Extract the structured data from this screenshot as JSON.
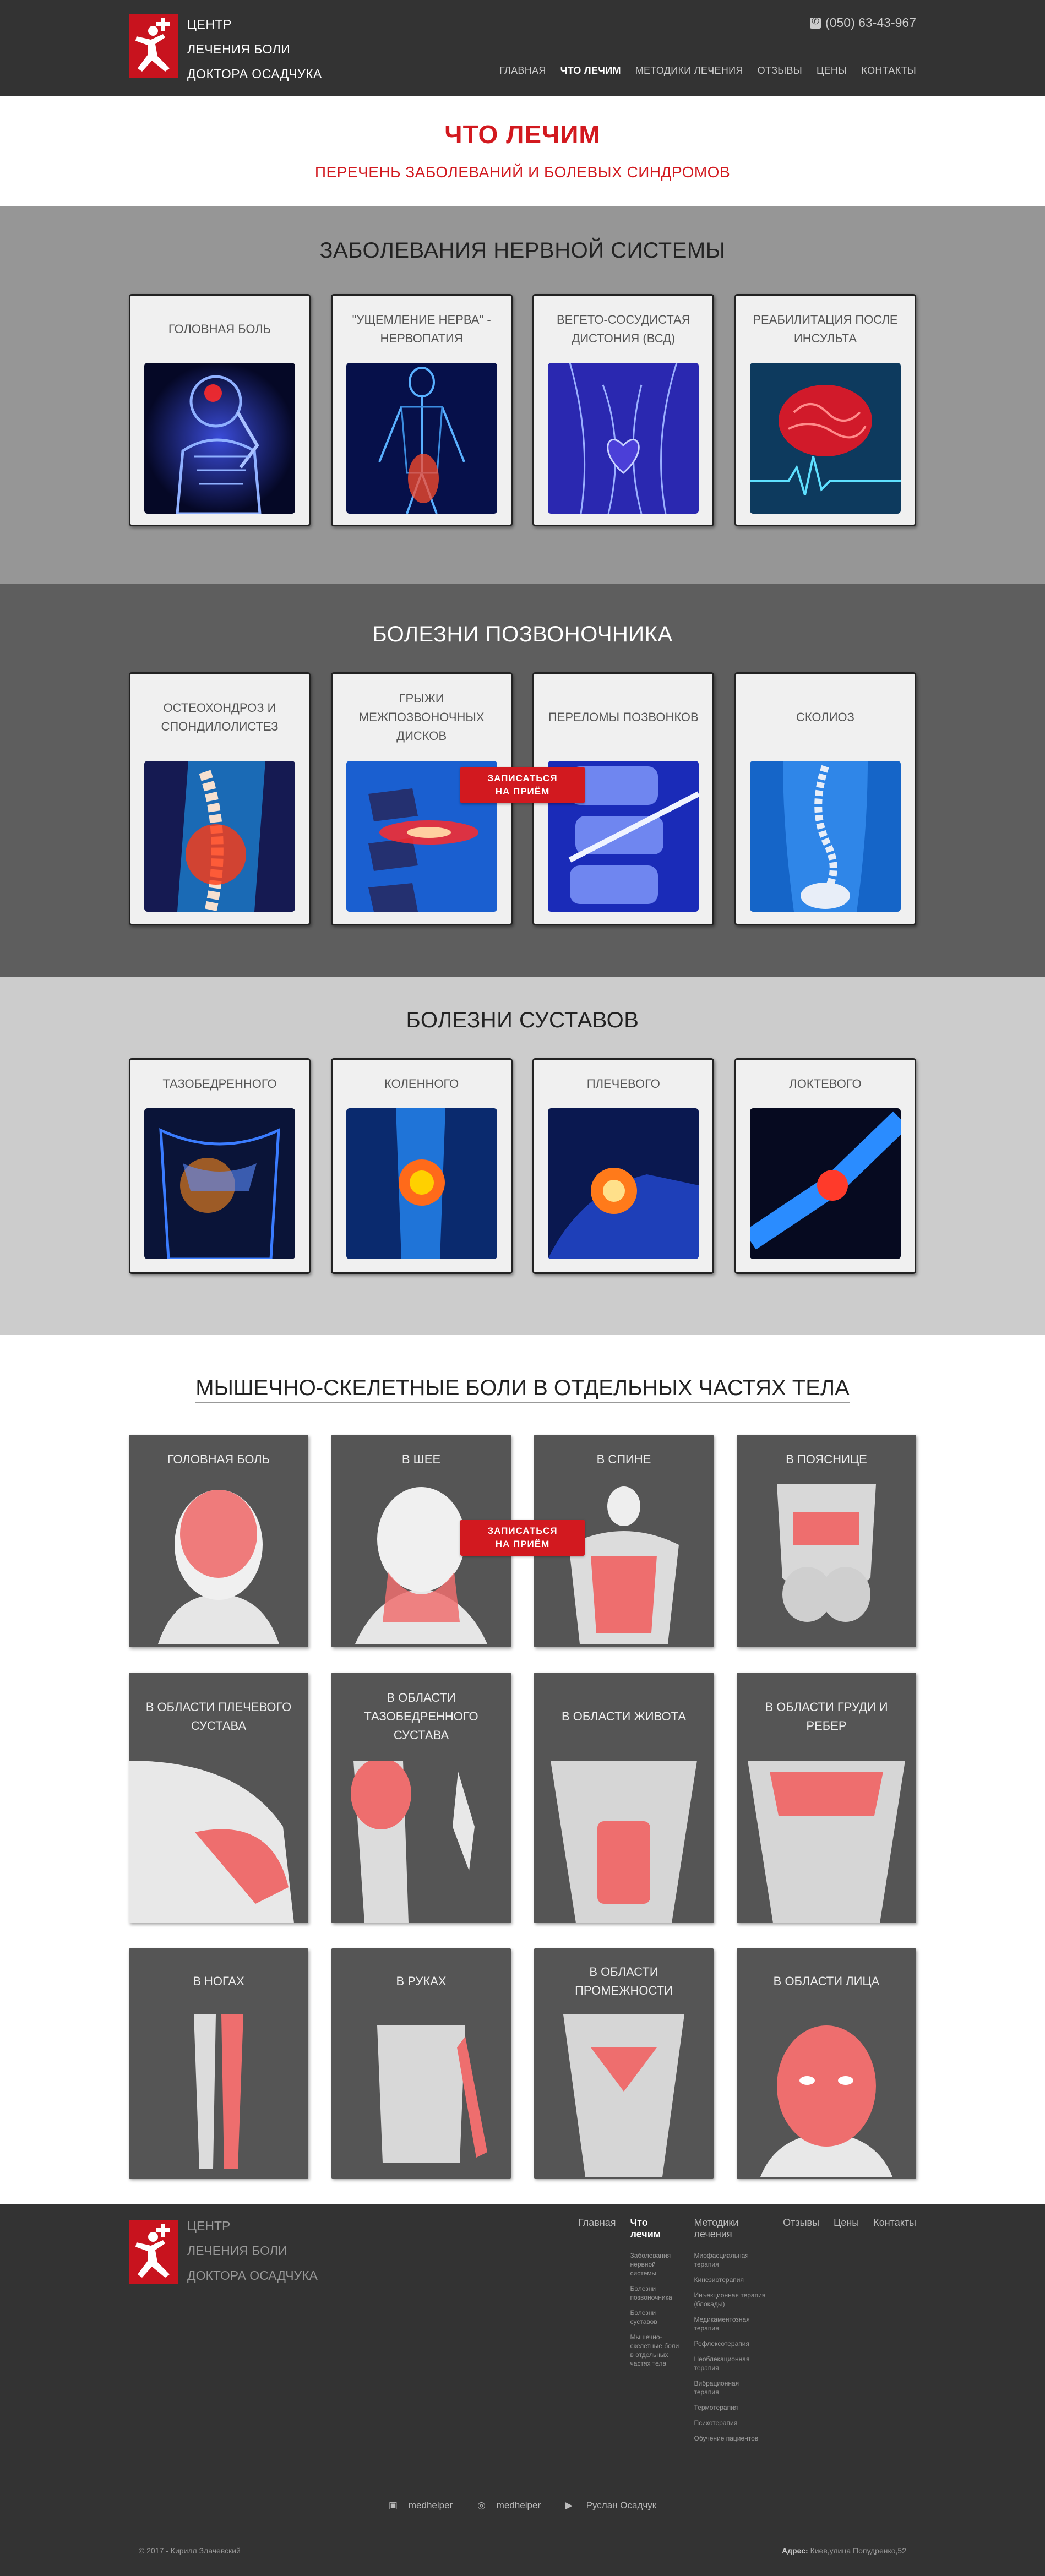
{
  "header": {
    "brand": [
      "ЦЕНТР",
      "ЛЕЧЕНИЯ БОЛИ",
      "ДОКТОРА ОСАДЧУКА"
    ],
    "phone": "(050) 63-43-967",
    "nav": [
      "ГЛАВНАЯ",
      "ЧТО ЛЕЧИМ",
      "МЕТОДИКИ ЛЕЧЕНИЯ",
      "ОТЗЫВЫ",
      "ЦЕНЫ",
      "КОНТАКТЫ"
    ]
  },
  "page": {
    "title": "ЧТО ЛЕЧИМ",
    "subtitle": "ПЕРЕЧЕНЬ ЗАБОЛЕВАНИЙ И БОЛЕВЫХ СИНДРОМОВ"
  },
  "sections": {
    "nervous": {
      "title": "ЗАБОЛЕВАНИЯ НЕРВНОЙ СИСТЕМЫ",
      "cards": [
        "ГОЛОВНАЯ БОЛЬ",
        "\"УЩЕМЛЕНИЕ НЕРВА\" - НЕРВОПАТИЯ",
        "ВЕГЕТО-СОСУДИСТАЯ ДИСТОНИЯ (ВСД)",
        "РЕАБИЛИТАЦИЯ ПОСЛЕ ИНСУЛЬТА"
      ]
    },
    "spine": {
      "title": "БОЛЕЗНИ ПОЗВОНОЧНИКА",
      "cards": [
        "ОСТЕОХОНДРОЗ И СПОНДИЛОЛИСТЕЗ",
        "ГРЫЖИ МЕЖПОЗВОНОЧНЫХ ДИСКОВ",
        "ПЕРЕЛОМЫ ПОЗВОНКОВ",
        "СКОЛИОЗ"
      ]
    },
    "joints": {
      "title": "БОЛЕЗНИ СУСТАВОВ",
      "cards": [
        "ТАЗОБЕДРЕННОГО",
        "КОЛЕННОГО",
        "ПЛЕЧЕВОГО",
        "ЛОКТЕВОГО"
      ]
    },
    "muscle": {
      "title": "МЫШЕЧНО-СКЕЛЕТНЫЕ БОЛИ В ОТДЕЛЬНЫХ ЧАСТЯХ ТЕЛА",
      "row1": [
        "ГОЛОВНАЯ БОЛЬ",
        "В ШЕЕ",
        "В СПИНЕ",
        "В ПОЯСНИЦЕ"
      ],
      "row2": [
        "В ОБЛАСТИ ПЛЕЧЕВОГО СУСТАВА",
        "В ОБЛАСТИ ТАЗОБЕДРЕННОГО СУСТАВА",
        "В ОБЛАСТИ ЖИВОТА",
        "В ОБЛАСТИ ГРУДИ И РЕБЕР"
      ],
      "row3": [
        "В НОГАХ",
        "В РУКАХ",
        "В ОБЛАСТИ ПРОМЕЖНОСТИ",
        "В ОБЛАСТИ ЛИЦА"
      ]
    }
  },
  "cta": {
    "line1": "ЗАПИСАТЬСЯ",
    "line2": "НА ПРИЁМ"
  },
  "footer": {
    "brand": [
      "ЦЕНТР",
      "ЛЕЧЕНИЯ БОЛИ",
      "ДОКТОРА ОСАДЧУКА"
    ],
    "nav": [
      "Главная",
      "Что лечим",
      "Методики лечения",
      "Отзывы",
      "Цены",
      "Контакты"
    ],
    "what_we_treat": [
      "Заболевания нервной системы",
      "Болезни позвоночника",
      "Болезни суставов",
      "Мышечно-скелетные боли в отдельных частях тела"
    ],
    "methods": [
      "Миофасциальная терапия",
      "Кинезиотерапия",
      "Инъекционная терапия (блокады)",
      "Медикаментозная терапия",
      "Рефлексотерапия",
      "Необлекационная терапия",
      "Вибрационная терапия",
      "Термотерапия",
      "Психотерапия",
      "Обучение пациентов"
    ],
    "social": [
      "medhelper",
      "medhelper",
      "Руслан Осадчук"
    ],
    "copyright": "© 2017 - Кирилл Злачевский",
    "address_label": "Адрес:",
    "address": "Киев,улица Попудренко,52"
  },
  "colors": {
    "accent": "#d2191f",
    "dark": "#333333"
  }
}
